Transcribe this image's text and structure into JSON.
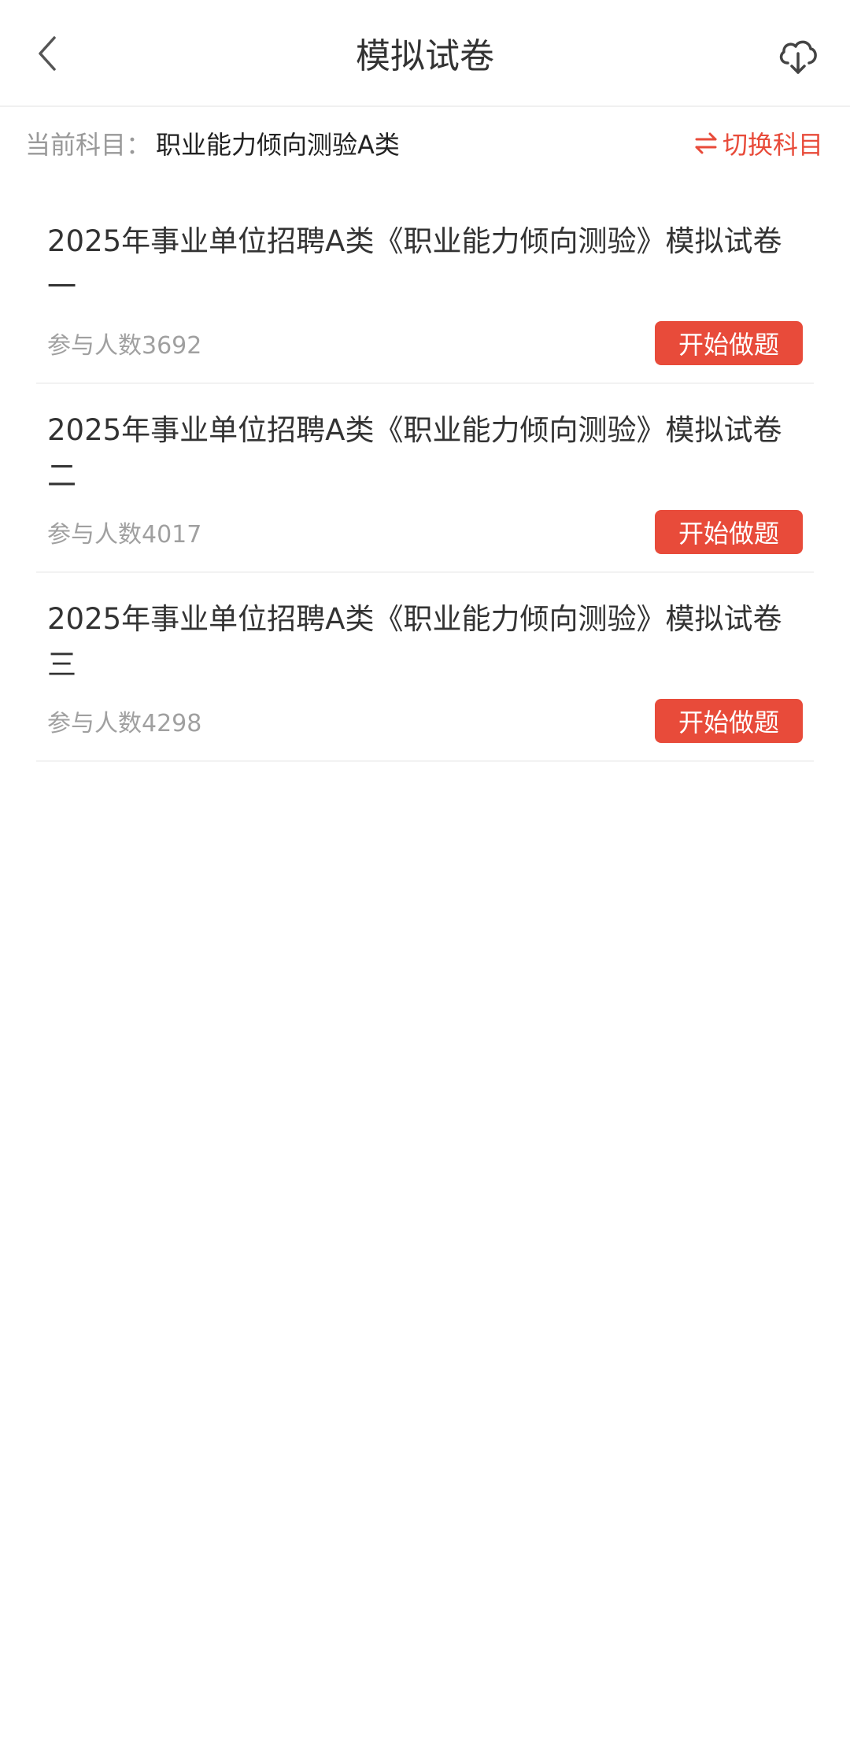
{
  "header": {
    "title": "模拟试卷",
    "back_icon": "chevron-left-icon",
    "download_icon": "cloud-download-icon"
  },
  "subject": {
    "label": "当前科目：",
    "name": "职业能力倾向测验A类",
    "switch_label": "切换科目",
    "switch_icon": "swap-arrows-icon"
  },
  "colors": {
    "accent": "#e84b3a",
    "text_primary": "#333333",
    "text_secondary": "#999999"
  },
  "exams": [
    {
      "title": "2025年事业单位招聘A类《职业能力倾向测验》模拟试卷一",
      "participants": "参与人数3692",
      "action": "开始做题"
    },
    {
      "title": "2025年事业单位招聘A类《职业能力倾向测验》模拟试卷二",
      "participants": "参与人数4017",
      "action": "开始做题"
    },
    {
      "title": "2025年事业单位招聘A类《职业能力倾向测验》模拟试卷三",
      "participants": "参与人数4298",
      "action": "开始做题"
    }
  ]
}
